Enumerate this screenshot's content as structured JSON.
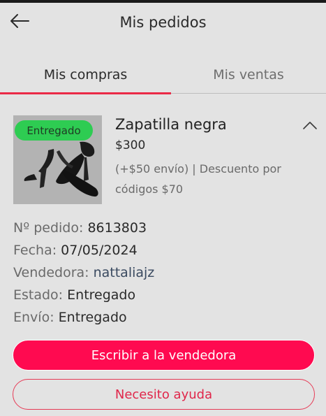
{
  "header": {
    "title": "Mis pedidos",
    "back_icon": "arrow-left-icon"
  },
  "tabs": [
    {
      "label": "Mis compras",
      "active": true
    },
    {
      "label": "Mis ventas",
      "active": false
    }
  ],
  "colors": {
    "accent": "#ff0a50",
    "active_tab_underline": "#ea2a47",
    "badge_delivered": "#2ecc52",
    "background": "#e3e3e3"
  },
  "order": {
    "status_badge": "Entregado",
    "product_name": "Zapatilla negra",
    "price": "$300",
    "extra_info": "(+$50 envío) | Descuento por códigos $70",
    "collapse_icon": "chevron-up-icon",
    "image_icon": "black-heel-shoe-image",
    "details": {
      "order_number_label": "Nº pedido:",
      "order_number": "8613803",
      "date_label": "Fecha:",
      "date": "07/05/2024",
      "seller_label": "Vendedora:",
      "seller": "nattaliajz",
      "status_label": "Estado:",
      "status": "Entregado",
      "shipping_label": "Envío:",
      "shipping": "Entregado"
    }
  },
  "actions": {
    "contact_seller": "Escribir a la vendedora",
    "need_help": "Necesito ayuda"
  }
}
